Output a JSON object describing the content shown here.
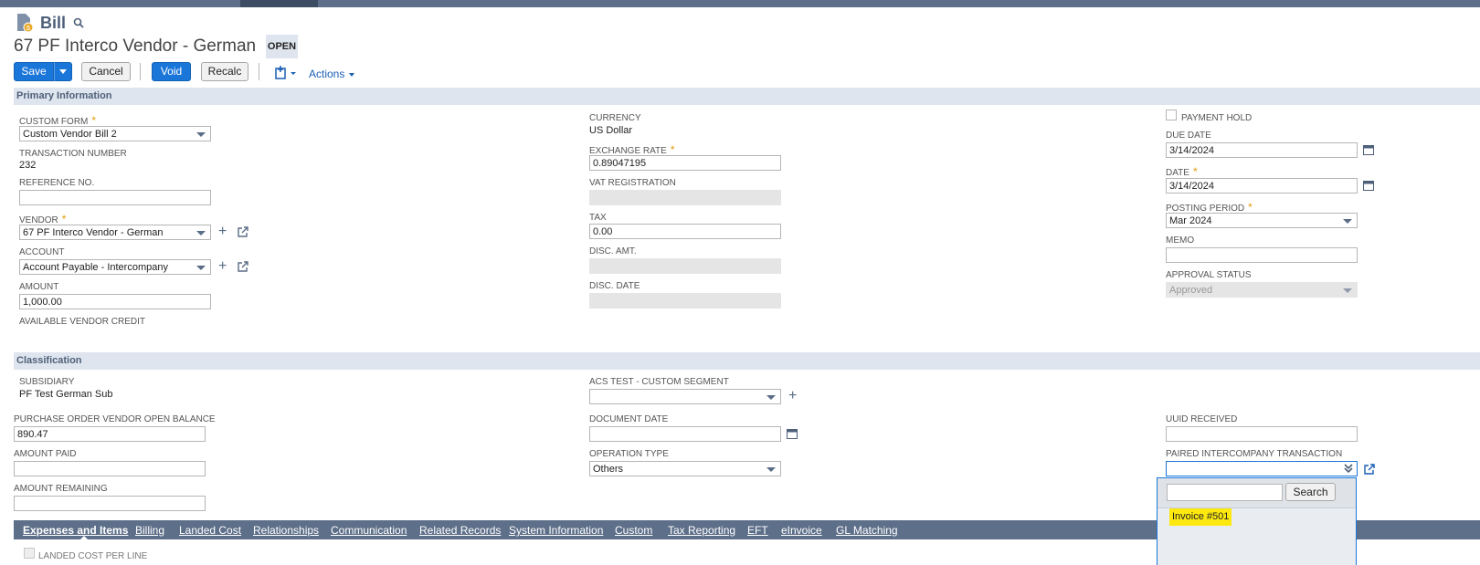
{
  "header": {
    "record_type": "Bill",
    "title": "67 PF Interco Vendor - German",
    "status": "OPEN"
  },
  "toolbar": {
    "save": "Save",
    "cancel": "Cancel",
    "void": "Void",
    "recalc": "Recalc",
    "actions": "Actions"
  },
  "primary": {
    "section_title": "Primary Information",
    "custom_form": {
      "label": "CUSTOM FORM",
      "value": "Custom Vendor Bill 2"
    },
    "transaction_number": {
      "label": "TRANSACTION NUMBER",
      "value": "232"
    },
    "reference_no": {
      "label": "REFERENCE NO.",
      "value": ""
    },
    "vendor": {
      "label": "VENDOR",
      "value": "67 PF Interco Vendor - German"
    },
    "account": {
      "label": "ACCOUNT",
      "value": "Account Payable - Intercompany"
    },
    "amount": {
      "label": "AMOUNT",
      "value": "1,000.00"
    },
    "available_credit": {
      "label": "AVAILABLE VENDOR CREDIT"
    },
    "currency": {
      "label": "CURRENCY",
      "value": "US Dollar"
    },
    "exchange_rate": {
      "label": "EXCHANGE RATE",
      "value": "0.89047195"
    },
    "vat_registration": {
      "label": "VAT REGISTRATION",
      "value": ""
    },
    "tax": {
      "label": "TAX",
      "value": "0.00"
    },
    "disc_amt": {
      "label": "DISC. AMT.",
      "value": ""
    },
    "disc_date": {
      "label": "DISC. DATE",
      "value": ""
    },
    "payment_hold": {
      "label": "PAYMENT HOLD",
      "checked": false
    },
    "due_date": {
      "label": "DUE DATE",
      "value": "3/14/2024"
    },
    "date": {
      "label": "DATE",
      "value": "3/14/2024"
    },
    "posting_period": {
      "label": "POSTING PERIOD",
      "value": "Mar 2024"
    },
    "memo": {
      "label": "MEMO",
      "value": ""
    },
    "approval_status": {
      "label": "APPROVAL STATUS",
      "value": "Approved"
    }
  },
  "classification": {
    "section_title": "Classification",
    "subsidiary": {
      "label": "SUBSIDIARY",
      "value": "PF Test German Sub"
    },
    "po_open_balance": {
      "label": "PURCHASE ORDER VENDOR OPEN BALANCE",
      "value": "890.47"
    },
    "amount_paid": {
      "label": "AMOUNT PAID",
      "value": ""
    },
    "amount_remaining": {
      "label": "AMOUNT REMAINING",
      "value": ""
    },
    "acs_segment": {
      "label": "ACS TEST - CUSTOM SEGMENT",
      "value": ""
    },
    "document_date": {
      "label": "DOCUMENT DATE",
      "value": ""
    },
    "operation_type": {
      "label": "OPERATION TYPE",
      "value": "Others"
    },
    "uuid_received": {
      "label": "UUID RECEIVED",
      "value": ""
    },
    "paired_ic": {
      "label": "PAIRED INTERCOMPANY TRANSACTION",
      "value": ""
    }
  },
  "popup": {
    "search_value": "",
    "search_button": "Search",
    "option": "Invoice #501"
  },
  "subtabs": [
    "Expenses and Items",
    "Billing",
    "Landed Cost",
    "Relationships",
    "Communication",
    "Related Records",
    "System Information",
    "Custom",
    "Tax Reporting",
    "EFT",
    "eInvoice",
    "GL Matching"
  ],
  "lines": {
    "landed_cost_per_line": {
      "label": "LANDED COST PER LINE",
      "checked": false
    }
  },
  "colors": {
    "accent": "#1a76d9",
    "nav": "#5d6f89",
    "section": "#dfe5ee",
    "required": "#e39b0b",
    "highlight": "#fde910"
  }
}
